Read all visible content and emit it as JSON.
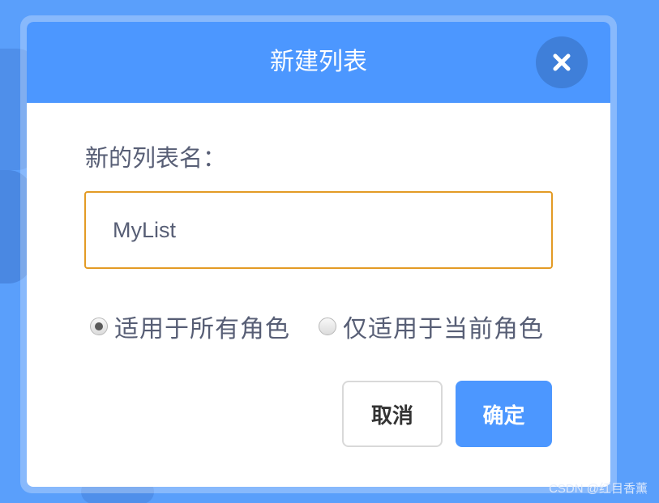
{
  "dialog": {
    "title": "新建列表",
    "close_icon": "close-icon",
    "field_label": "新的列表名：",
    "name_input": {
      "value": "MyList",
      "placeholder": ""
    },
    "scope_options": [
      {
        "label": "适用于所有角色",
        "checked": true
      },
      {
        "label": "仅适用于当前角色",
        "checked": false
      }
    ],
    "cancel_label": "取消",
    "ok_label": "确定"
  },
  "colors": {
    "header": "#4c97ff",
    "close_button": "#3f7fd9",
    "input_border": "#e39b25",
    "ok_button": "#4c97ff",
    "background": "#5a9ffb"
  },
  "watermark": "CSDN @红目香薰"
}
